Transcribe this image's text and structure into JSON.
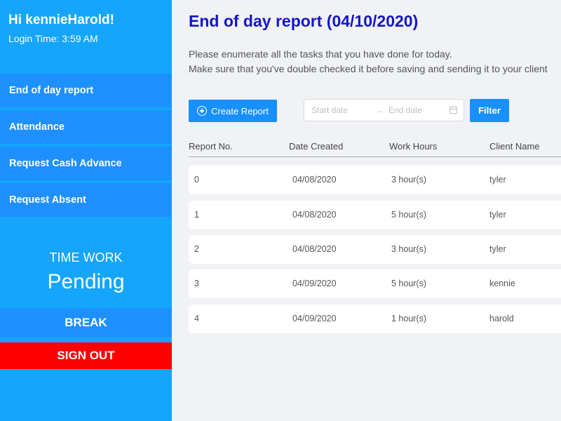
{
  "sidebar": {
    "greeting": "Hi kennieHarold!",
    "login_time": "Login Time: 3:59 AM",
    "nav": [
      {
        "label": "End of day report"
      },
      {
        "label": "Attendance"
      },
      {
        "label": "Request Cash Advance"
      },
      {
        "label": "Request Absent"
      }
    ],
    "time_label": "TIME WORK",
    "time_value": "Pending",
    "break_label": "BREAK",
    "signout_label": "SIGN OUT"
  },
  "main": {
    "title": "End of day report (04/10/2020)",
    "desc_line1": "Please enumerate all the tasks that you have done for today.",
    "desc_line2": "Make sure that you've double checked it before saving and sending it to your client",
    "create_label": "Create Report",
    "start_placeholder": "Start date",
    "arrow": "→",
    "end_placeholder": "End date",
    "filter_label": "Filter",
    "columns": [
      "Report No.",
      "Date Created",
      "Work Hours",
      "Client Name"
    ],
    "rows": [
      {
        "no": "0",
        "date": "04/08/2020",
        "hours": "3 hour(s)",
        "client": "tyler"
      },
      {
        "no": "1",
        "date": "04/08/2020",
        "hours": "5 hour(s)",
        "client": "tyler"
      },
      {
        "no": "2",
        "date": "04/08/2020",
        "hours": "3 hour(s)",
        "client": "tyler"
      },
      {
        "no": "3",
        "date": "04/09/2020",
        "hours": "5 hour(s)",
        "client": "kennie"
      },
      {
        "no": "4",
        "date": "04/09/2020",
        "hours": "1 hour(s)",
        "client": "harold"
      }
    ]
  },
  "colors": {
    "sidebar_bg": "#15a5fb",
    "nav_bg": "#1e90ff",
    "signout_bg": "#ff0000",
    "primary_button": "#1890ff",
    "title": "#1414c8"
  }
}
